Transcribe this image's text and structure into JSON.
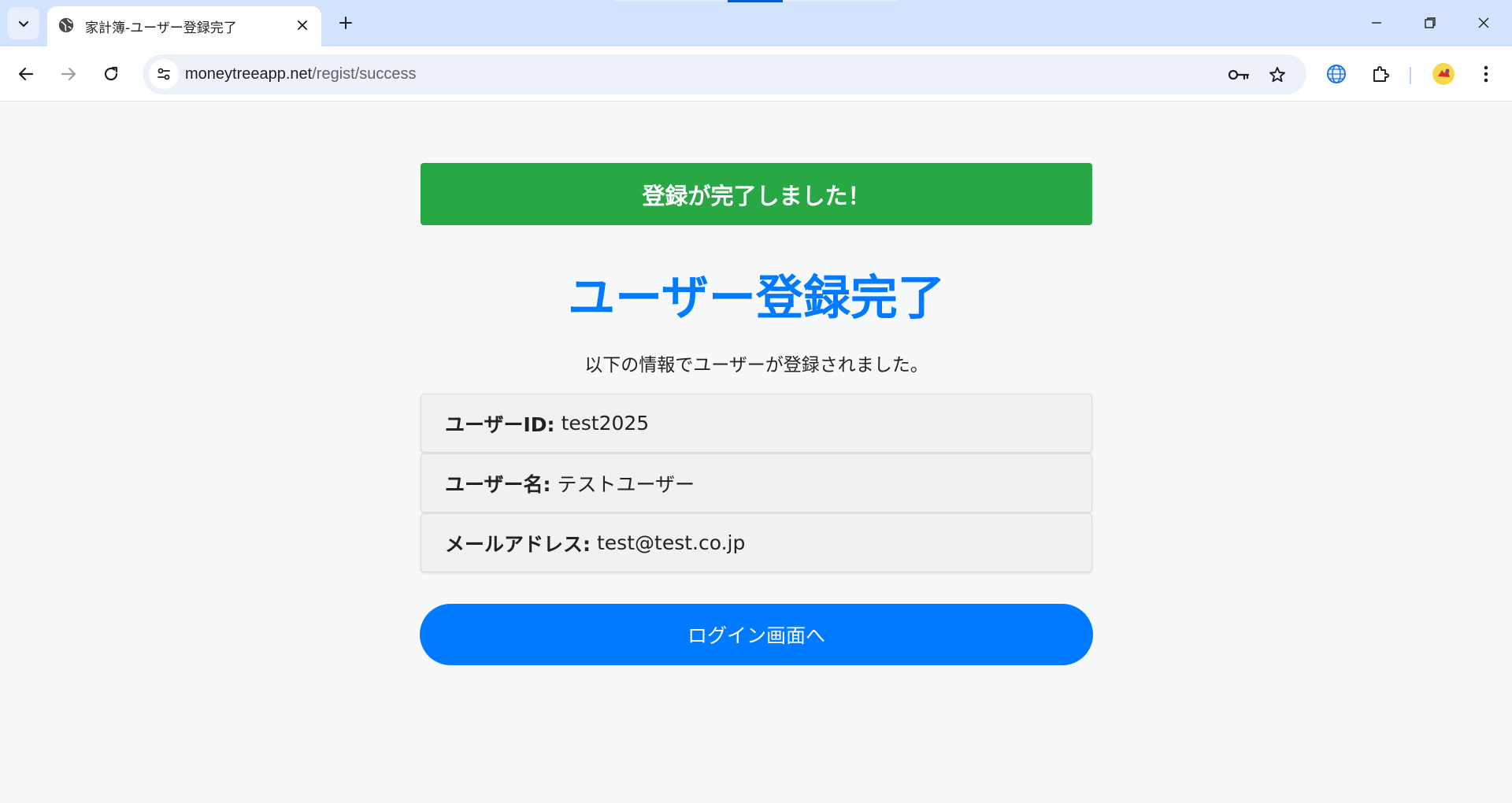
{
  "browser": {
    "tab": {
      "title": "家計簿-ユーザー登録完了",
      "favicon": "globe-icon"
    },
    "url": {
      "host": "moneytreeapp.net",
      "path": "/regist/success"
    },
    "icons": [
      "tab-search-icon",
      "globe-icon",
      "close-icon",
      "plus-icon",
      "minimize-icon",
      "restore-icon",
      "window-close-icon",
      "back-arrow-icon",
      "forward-arrow-icon",
      "reload-icon",
      "site-settings-icon",
      "key-icon",
      "star-icon",
      "globe-extension-icon",
      "puzzle-icon",
      "profile-avatar-icon",
      "more-vert-icon"
    ]
  },
  "page": {
    "alert": "登録が完了しました！",
    "heading": "ユーザー登録完了",
    "lead": "以下の情報でユーザーが登録されました。",
    "fields": [
      {
        "label": "ユーザーID:",
        "value": "test2025"
      },
      {
        "label": "ユーザー名:",
        "value": "テストユーザー"
      },
      {
        "label": "メールアドレス:",
        "value": "test@test.co.jp"
      }
    ],
    "login_button": "ログイン画面へ"
  },
  "colors": {
    "alert_bg": "#28a745",
    "accent_blue": "#007bff",
    "page_bg": "#f7f8fa",
    "tabstrip_bg": "#d3e3fd"
  }
}
